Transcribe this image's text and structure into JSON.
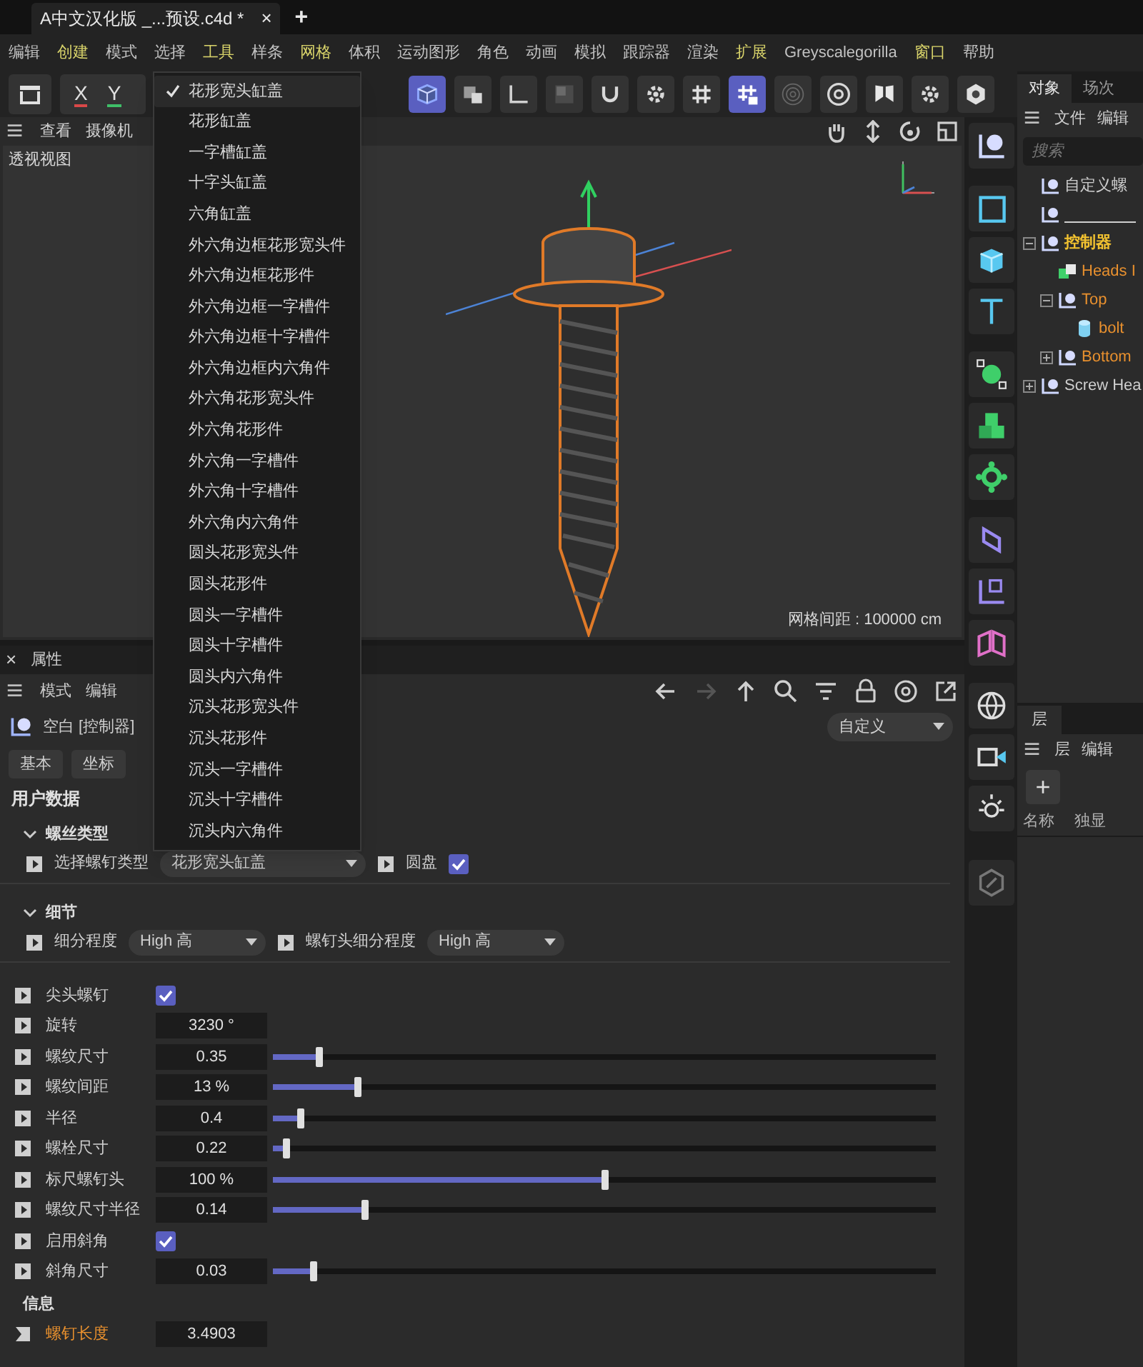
{
  "window": {
    "tab_title": "A中文汉化版 _...预设.c4d *",
    "close": "×",
    "new_tab": "+"
  },
  "menu_bar": [
    {
      "label": "编辑",
      "highlighted": false
    },
    {
      "label": "创建",
      "highlighted": true
    },
    {
      "label": "模式",
      "highlighted": false
    },
    {
      "label": "选择",
      "highlighted": false
    },
    {
      "label": "工具",
      "highlighted": true
    },
    {
      "label": "样条",
      "highlighted": false
    },
    {
      "label": "网格",
      "highlighted": true
    },
    {
      "label": "体积",
      "highlighted": false
    },
    {
      "label": "运动图形",
      "highlighted": false
    },
    {
      "label": "角色",
      "highlighted": false
    },
    {
      "label": "动画",
      "highlighted": false
    },
    {
      "label": "模拟",
      "highlighted": false
    },
    {
      "label": "跟踪器",
      "highlighted": false
    },
    {
      "label": "渲染",
      "highlighted": false
    },
    {
      "label": "扩展",
      "highlighted": true
    },
    {
      "label": "Greyscalegorilla",
      "highlighted": false
    },
    {
      "label": "窗口",
      "highlighted": true
    },
    {
      "label": "帮助",
      "highlighted": false
    }
  ],
  "toolbar": {
    "axes": [
      {
        "label": "X",
        "color": "#d94848"
      },
      {
        "label": "Y",
        "color": "#3fbf68"
      }
    ],
    "buttons": [
      {
        "kind": "cube",
        "active": true
      },
      {
        "kind": "cubes",
        "active": false
      },
      {
        "kind": "corner",
        "active": false
      },
      {
        "kind": "square",
        "active": false
      },
      {
        "kind": "magnet",
        "active": false
      },
      {
        "kind": "gear",
        "active": false
      },
      {
        "kind": "grid",
        "active": false
      },
      {
        "kind": "grid-lock",
        "active": true
      },
      {
        "kind": "rings",
        "active": false
      },
      {
        "kind": "target",
        "active": false
      },
      {
        "kind": "butterfly",
        "active": false
      },
      {
        "kind": "gear",
        "active": false
      },
      {
        "kind": "hexagon",
        "active": false
      }
    ]
  },
  "viewport": {
    "menu": [
      "查看",
      "摄像机"
    ],
    "label": "透视视图",
    "grid_spacing": "网格间距 : 100000 cm"
  },
  "type_dropdown": {
    "items": [
      {
        "label": "花形宽头缸盖",
        "selected": true
      },
      {
        "label": "花形缸盖",
        "selected": false
      },
      {
        "label": "一字槽缸盖",
        "selected": false
      },
      {
        "label": "十字头缸盖",
        "selected": false
      },
      {
        "label": "六角缸盖",
        "selected": false
      },
      {
        "label": "外六角边框花形宽头件",
        "selected": false
      },
      {
        "label": "外六角边框花形件",
        "selected": false
      },
      {
        "label": "外六角边框一字槽件",
        "selected": false
      },
      {
        "label": "外六角边框十字槽件",
        "selected": false
      },
      {
        "label": "外六角边框内六角件",
        "selected": false
      },
      {
        "label": "外六角花形宽头件",
        "selected": false
      },
      {
        "label": "外六角花形件",
        "selected": false
      },
      {
        "label": "外六角一字槽件",
        "selected": false
      },
      {
        "label": "外六角十字槽件",
        "selected": false
      },
      {
        "label": "外六角内六角件",
        "selected": false
      },
      {
        "label": "圆头花形宽头件",
        "selected": false
      },
      {
        "label": "圆头花形件",
        "selected": false
      },
      {
        "label": "圆头一字槽件",
        "selected": false
      },
      {
        "label": "圆头十字槽件",
        "selected": false
      },
      {
        "label": "圆头内六角件",
        "selected": false
      },
      {
        "label": "沉头花形宽头件",
        "selected": false
      },
      {
        "label": "沉头花形件",
        "selected": false
      },
      {
        "label": "沉头一字槽件",
        "selected": false
      },
      {
        "label": "沉头十字槽件",
        "selected": false
      },
      {
        "label": "沉头内六角件",
        "selected": false
      }
    ]
  },
  "attributes": {
    "title": "属性",
    "close": "×",
    "menu": [
      "模式",
      "编辑"
    ],
    "object_name": "空白 [控制器]",
    "preset": "自定义",
    "tabs": [
      {
        "label": "基本",
        "selected": false
      },
      {
        "label": "坐标",
        "selected": false
      }
    ],
    "section": "用户数据",
    "groups": [
      {
        "title": "螺丝类型",
        "expanded": true,
        "fields": [
          {
            "kind": "dropdown",
            "label": "选择螺钉类型",
            "value": "花形宽头缸盖"
          },
          {
            "kind": "checkbox",
            "label": "圆盘",
            "checked": true
          }
        ]
      },
      {
        "title": "细节",
        "expanded": true,
        "fields": [
          {
            "kind": "dropdown",
            "label": "细分程度",
            "value": "High 高"
          },
          {
            "kind": "dropdown",
            "label": "螺钉头细分程度",
            "value": "High 高"
          }
        ]
      }
    ],
    "rows": [
      {
        "kind": "checkbox",
        "label": "尖头螺钉",
        "checked": true
      },
      {
        "kind": "number",
        "label": "旋转",
        "value": "3230 °"
      },
      {
        "kind": "slider",
        "label": "螺纹尺寸",
        "value": "0.35",
        "level": 0.07
      },
      {
        "kind": "slider",
        "label": "螺纹间距",
        "value": "13 %",
        "level": 0.128
      },
      {
        "kind": "slider",
        "label": "半径",
        "value": "0.4",
        "level": 0.04
      },
      {
        "kind": "slider",
        "label": "螺栓尺寸",
        "value": "0.22",
        "level": 0.02
      },
      {
        "kind": "slider",
        "label": "标尺螺钉头",
        "value": "100 %",
        "level": 0.5
      },
      {
        "kind": "slider",
        "label": "螺纹尺寸半径",
        "value": "0.14",
        "level": 0.138
      },
      {
        "kind": "checkbox",
        "label": "启用斜角",
        "checked": true
      },
      {
        "kind": "slider",
        "label": "斜角尺寸",
        "value": "0.03",
        "level": 0.06
      }
    ],
    "info_title": "信息",
    "info_rows": [
      {
        "kind": "output",
        "label": "螺钉长度",
        "value": "3.4903"
      }
    ]
  },
  "objects_panel": {
    "tabs": [
      {
        "label": "对象",
        "selected": true
      },
      {
        "label": "场次",
        "selected": false
      }
    ],
    "menu": [
      "文件",
      "编辑"
    ],
    "search": {
      "placeholder": "搜索"
    },
    "tree": [
      {
        "label": "自定义螺",
        "kind": "null",
        "selected": false
      },
      {
        "kind": "null",
        "editing": true
      },
      {
        "label": "控制器",
        "kind": "null",
        "selected": true,
        "expanded": true,
        "children": [
          {
            "label": "Heads I",
            "kind": "instance",
            "selected": false
          },
          {
            "label": "Top",
            "kind": "null",
            "selected": false,
            "expanded": true,
            "children": [
              {
                "label": "bolt",
                "kind": "cylinder",
                "selected": false
              }
            ]
          },
          {
            "label": "Bottom",
            "kind": "null",
            "selected": false,
            "expanded": false
          }
        ]
      },
      {
        "label": "Screw Hea",
        "kind": "null",
        "selected": false,
        "expanded": false
      }
    ]
  },
  "layers_panel": {
    "tab": "层",
    "menu": [
      "层",
      "编辑"
    ],
    "add": "+",
    "columns": [
      "名称",
      "独显"
    ]
  }
}
